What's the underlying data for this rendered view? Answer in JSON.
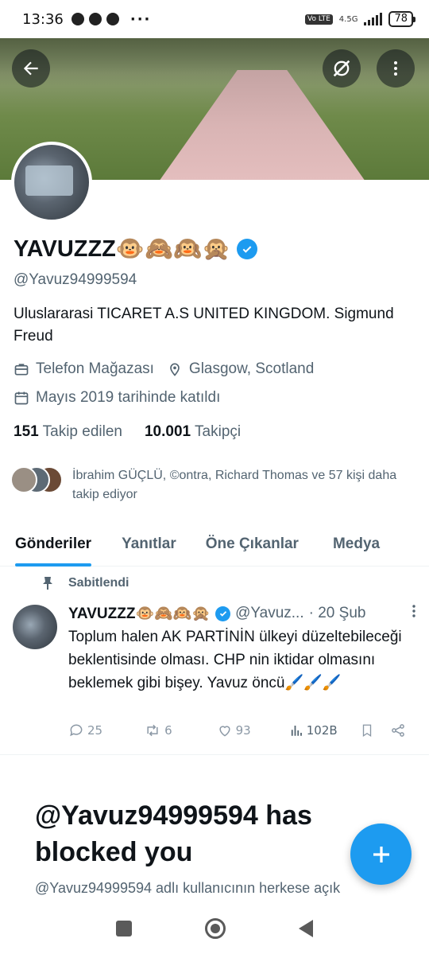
{
  "status_bar": {
    "time": "13:36",
    "notification_icons": [
      "facebook-icon",
      "messenger-icon",
      "facebook-icon"
    ],
    "more": "···",
    "volte": "Vo LTE",
    "network": "4.5G",
    "battery": "78"
  },
  "header": {
    "back_icon": "arrow-left-icon",
    "grok_icon": "grok-icon",
    "more_icon": "more-vertical-icon"
  },
  "profile": {
    "name": "YAVUZZZ🐵🙈🙉🙊",
    "handle": "@Yavuz94999594",
    "bio": "Uluslararasi TICARET A.S UNITED KINGDOM. Sigmund Freud",
    "category": "Telefon Mağazası",
    "location": "Glasgow, Scotland",
    "joined": "Mayıs 2019 tarihinde katıldı",
    "following_count": "151",
    "following_label": "Takip edilen",
    "followers_count": "10.001",
    "followers_label": "Takipçi",
    "followed_by": "İbrahim GÜÇLÜ, ©ontra, Richard Thomas ve 57 kişi daha takip ediyor"
  },
  "tabs": [
    "Gönderiler",
    "Yanıtlar",
    "Öne Çıkanlar",
    "Medya"
  ],
  "pinned_tweet": {
    "pinned_label": "Sabitlendi",
    "name": "YAVUZZZ🐵🙈🙉🙊",
    "handle": "@Yavuz...",
    "time": "· 20 Şub",
    "text": "Toplum halen AK PARTİNİN ülkeyi düzeltebileceği  beklentisinde olması. CHP nin iktidar olmasını beklemek gibi bişey. Yavuz öncü🖌️🖌️🖌️",
    "replies": "25",
    "retweets": "6",
    "likes": "93",
    "views": "102B"
  },
  "blocked": {
    "title": "@Yavuz94999594 has blocked you",
    "subtitle": "@Yavuz94999594 adlı kullanıcının herkese açık"
  },
  "colors": {
    "accent": "#1d9bf0",
    "text_primary": "#0f1419",
    "text_secondary": "#536471"
  }
}
